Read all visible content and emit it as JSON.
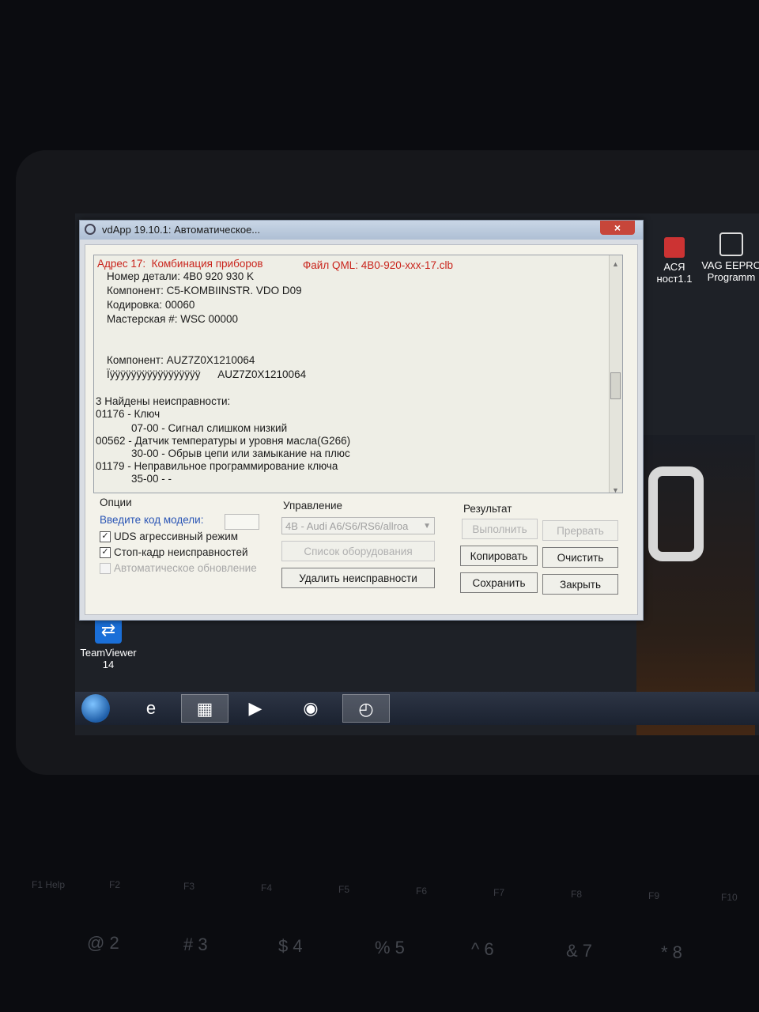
{
  "window": {
    "title": "vdApp 19.10.1:  Автоматическое...",
    "close_glyph": "×"
  },
  "log": {
    "address": "Адрес 17:  Комбинация приборов",
    "qml_file": "Файл QML: 4B0-920-xxx-17.clb",
    "lines": [
      "Номер детали: 4B0 920 930 K",
      "Компонент: C5-KOMBIINSTR. VDO D09",
      "Кодировка: 00060",
      "Мастерская #: WSC 00000",
      "Компонент: AUZ7Z0X1210064",
      "Ïÿÿÿÿÿÿÿÿÿÿÿÿÿÿÿÿÿ      AUZ7Z0X1210064",
      "3 Найдены неисправности:",
      "01176 - Ключ",
      "            07-00 - Сигнал слишком низкий",
      "00562 - Датчик температуры и уровня масла(G266)",
      "            30-00 - Обрыв цепи или замыкание на плюс",
      "01179 - Неправильное программирование ключа",
      "            35-00 - -"
    ]
  },
  "options": {
    "header": "Опции",
    "model_code_label": "Введите код модели:",
    "uds_label": "UDS агрессивный режим",
    "freeze_frame_label": "Стоп-кадр неисправностей",
    "auto_update_label": "Автоматическое обновление"
  },
  "control": {
    "header": "Управление",
    "selected_vehicle": "4B - Audi A6/S6/RS6/allroa",
    "equipment_list_label": "Список оборудования",
    "delete_faults_label": "Удалить неисправности"
  },
  "result": {
    "header": "Результат",
    "execute_label": "Выполнить",
    "abort_label": "Прервать",
    "copy_label": "Копировать",
    "clear_label": "Очистить",
    "save_label": "Сохранить",
    "close_label": "Закрыть"
  },
  "desktop": {
    "teamviewer_line1": "TeamViewer",
    "teamviewer_line2": "14",
    "app1_line1": "АСЯ",
    "app1_line2": "ност1.1",
    "vag_line1": "VAG EEPRO",
    "vag_line2": "Programm"
  },
  "keyboard": {
    "fkeys": [
      "F1 Help",
      "F2",
      "F3",
      "F4",
      "F5",
      "F6",
      "F7",
      "F8",
      "F9",
      "F10"
    ],
    "numkeys": [
      "@ 2",
      "# 3",
      "$ 4",
      "% 5",
      "^ 6",
      "& 7",
      "* 8"
    ]
  },
  "colors": {
    "red_text": "#c9241c",
    "blue_label": "#2a55b5"
  }
}
